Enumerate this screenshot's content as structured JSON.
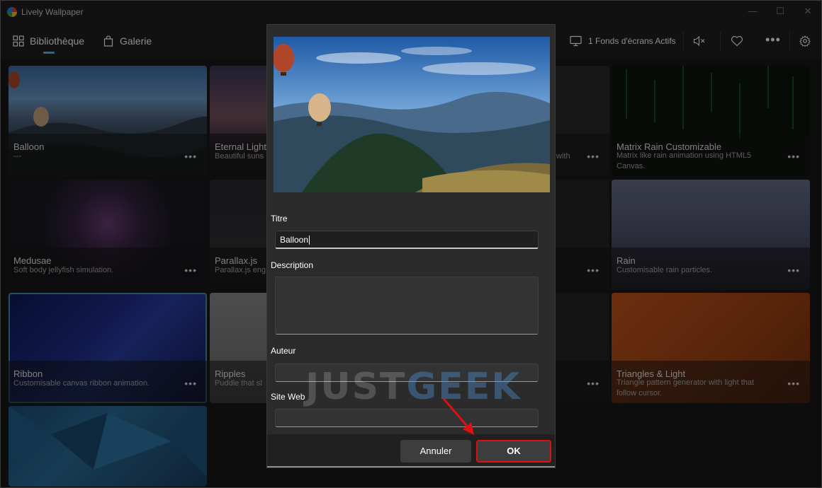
{
  "window": {
    "title": "Lively Wallpaper",
    "min": "—",
    "max": "☐",
    "close": "✕"
  },
  "nav": {
    "library_label": "Bibliothèque",
    "gallery_label": "Galerie"
  },
  "toolbar": {
    "active_wallpapers_label": "1 Fonds d'écrans Actifs",
    "more": "•••"
  },
  "library": {
    "cards": [
      {
        "title": "Balloon",
        "description": "---"
      },
      {
        "title": "Eternal Light",
        "description": "Beautiful suns"
      },
      {
        "title": "",
        "description": "with"
      },
      {
        "title": "Matrix Rain Customizable",
        "description": "Matrix like rain animation using HTML5 Canvas."
      },
      {
        "title": "Medusae",
        "description": "Soft body jellyfish simulation."
      },
      {
        "title": "Parallax.js",
        "description": "Parallax.js eng"
      },
      {
        "title": "",
        "description": ""
      },
      {
        "title": "Rain",
        "description": "Customisable rain particles."
      },
      {
        "title": "Ribbon",
        "description": "Customisable canvas ribbon animation."
      },
      {
        "title": "Ripples",
        "description": "Puddle that sl"
      },
      {
        "title": "",
        "description": ""
      },
      {
        "title": "Triangles & Light",
        "description": "Triangle pattern generator with light that follow cursor."
      },
      {
        "title": "",
        "description": ""
      }
    ],
    "more_label": "•••"
  },
  "dialog": {
    "title_label": "Titre",
    "title_value": "Balloon",
    "description_label": "Description",
    "description_value": "",
    "author_label": "Auteur",
    "author_value": "",
    "website_label": "Site Web",
    "website_value": "",
    "cancel_label": "Annuler",
    "ok_label": "OK"
  },
  "watermark": {
    "part1": "JUST",
    "part2": "GEEK"
  },
  "colors": {
    "accent": "#4cc2ff",
    "highlight": "#e01010",
    "dialog_bg": "#2b2b2b"
  }
}
